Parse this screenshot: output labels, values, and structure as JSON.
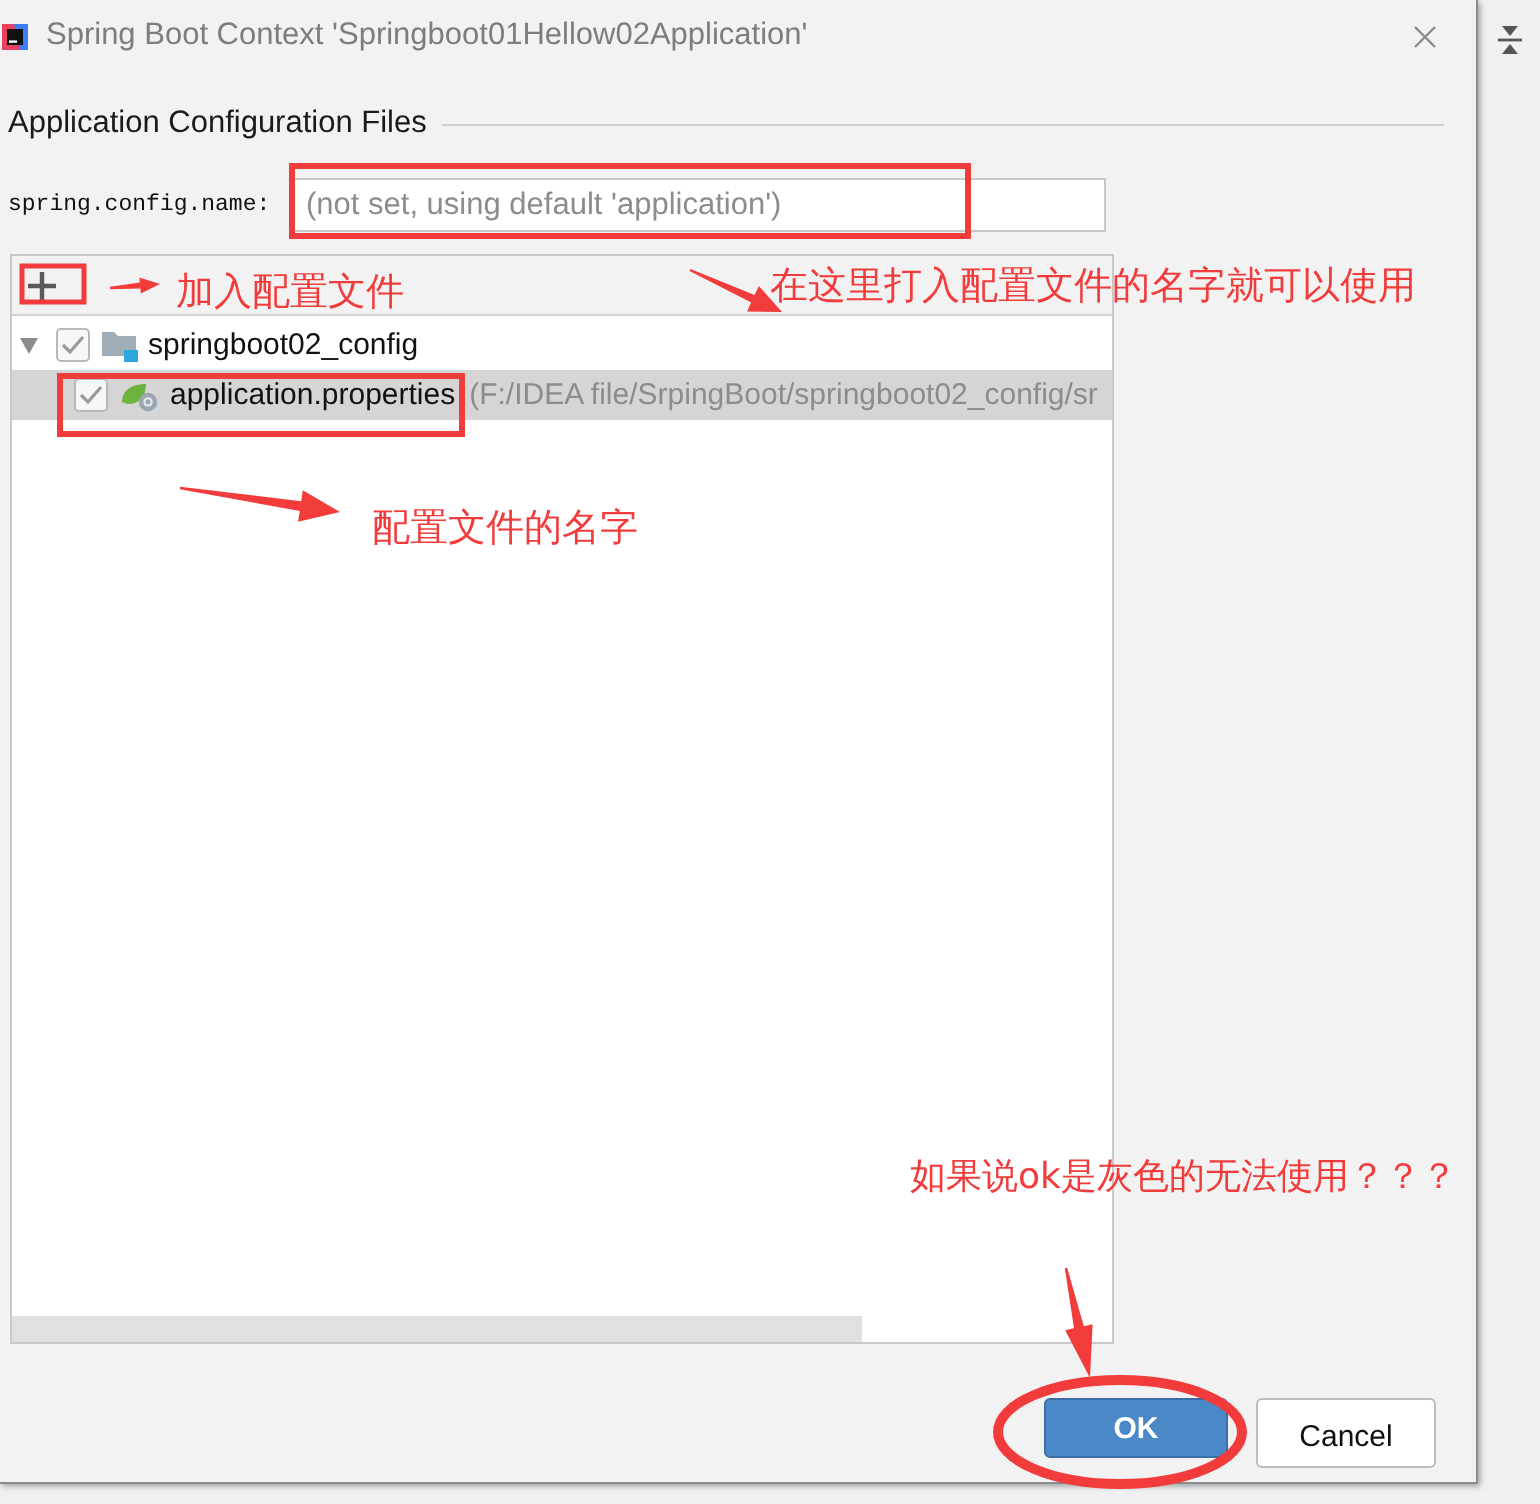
{
  "window": {
    "title": "Spring Boot Context 'Springboot01Hellow02Application'"
  },
  "section": {
    "title": "Application Configuration Files"
  },
  "config_name": {
    "label": "spring.config.name:",
    "placeholder": "(not set, using default 'application')"
  },
  "tree": {
    "items": [
      {
        "kind": "module",
        "label": "springboot02_config",
        "checked": true,
        "expanded": true,
        "selected": false,
        "children": [
          {
            "kind": "file",
            "label": "application.properties",
            "path": "(F:/IDEA file/SrpingBoot/springboot02_config/sr",
            "checked": true,
            "selected": true
          }
        ]
      }
    ]
  },
  "buttons": [
    {
      "kind": "primary",
      "label": "OK"
    },
    {
      "kind": "secondary",
      "label": "Cancel"
    }
  ],
  "annotations": [
    "加入配置文件",
    "在这里打入配置文件的名字就可以使用",
    "配置文件的名字",
    "如果说ok是灰色的无法使用？？？"
  ]
}
